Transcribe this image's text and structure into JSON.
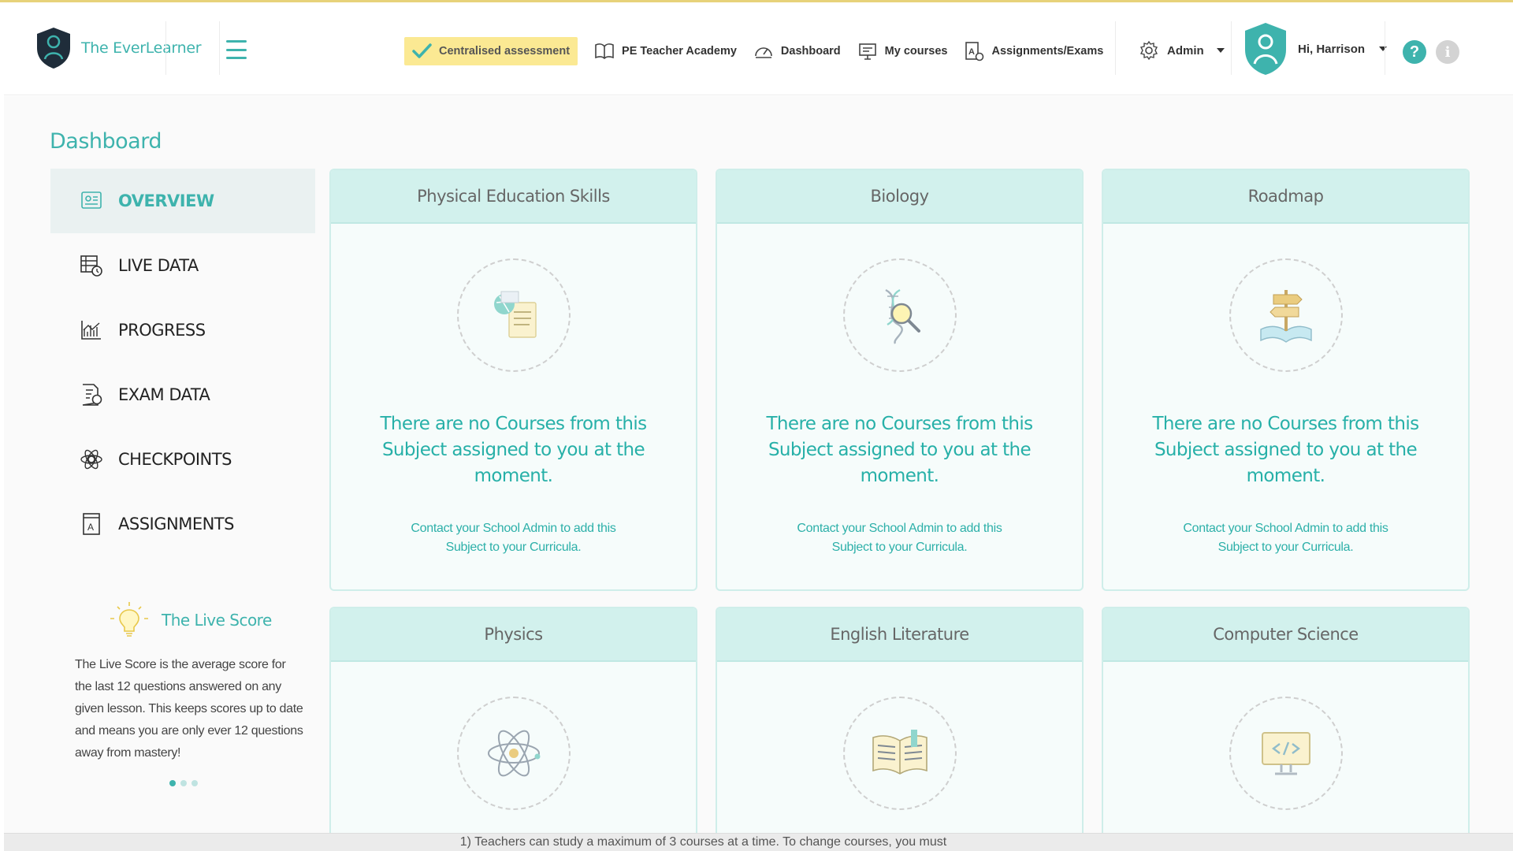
{
  "header": {
    "brand": "The EverLearner",
    "nav": [
      {
        "label": "Centralised assessment",
        "icon": "check-icon"
      },
      {
        "label": "PE Teacher Academy",
        "icon": "book-icon"
      },
      {
        "label": "Dashboard",
        "icon": "speedometer-icon"
      },
      {
        "label": "My courses",
        "icon": "presentation-icon"
      },
      {
        "label": "Assignments/Exams",
        "icon": "assignment-icon"
      }
    ],
    "admin_label": "Admin",
    "user_greeting": "Hi, Harrison",
    "help_label": "?",
    "info_label": "i"
  },
  "page": {
    "title": "Dashboard"
  },
  "sidebar": {
    "items": [
      {
        "label": "OVERVIEW",
        "icon": "overview-icon",
        "active": true
      },
      {
        "label": "LIVE DATA",
        "icon": "live-data-icon"
      },
      {
        "label": "PROGRESS",
        "icon": "chart-icon"
      },
      {
        "label": "EXAM DATA",
        "icon": "exam-icon"
      },
      {
        "label": "CHECKPOINTS",
        "icon": "checkpoint-icon"
      },
      {
        "label": "ASSIGNMENTS",
        "icon": "assignment-icon"
      }
    ]
  },
  "live_score": {
    "title": "The Live Score",
    "text": "The Live Score is the average score for the last 12 questions answered on any given lesson. This keeps scores up to date and means you are only ever 12 questions away from mastery!"
  },
  "cards": [
    {
      "title": "Physical Education Skills",
      "icon": "pe-skills-icon",
      "message": "There are no Courses from this Subject assigned to you at the moment.",
      "contact": "Contact your School Admin to add this Subject to your Curricula."
    },
    {
      "title": "Biology",
      "icon": "dna-icon",
      "message": "There are no Courses from this Subject assigned to you at the moment.",
      "contact": "Contact your School Admin to add this Subject to your Curricula."
    },
    {
      "title": "Roadmap",
      "icon": "signpost-icon",
      "message": "There are no Courses from this Subject assigned to you at the moment.",
      "contact": "Contact your School Admin to add this Subject to your Curricula."
    },
    {
      "title": "Physics",
      "icon": "atom-icon"
    },
    {
      "title": "English Literature",
      "icon": "open-book-icon"
    },
    {
      "title": "Computer Science",
      "icon": "computer-icon"
    }
  ],
  "footer": {
    "text": "1) Teachers can study a maximum of 3 courses at a time. To change courses, you must"
  },
  "colors": {
    "accent": "#3eb3ad",
    "highlight": "#fbe993",
    "card_header": "#d2f1ed"
  }
}
